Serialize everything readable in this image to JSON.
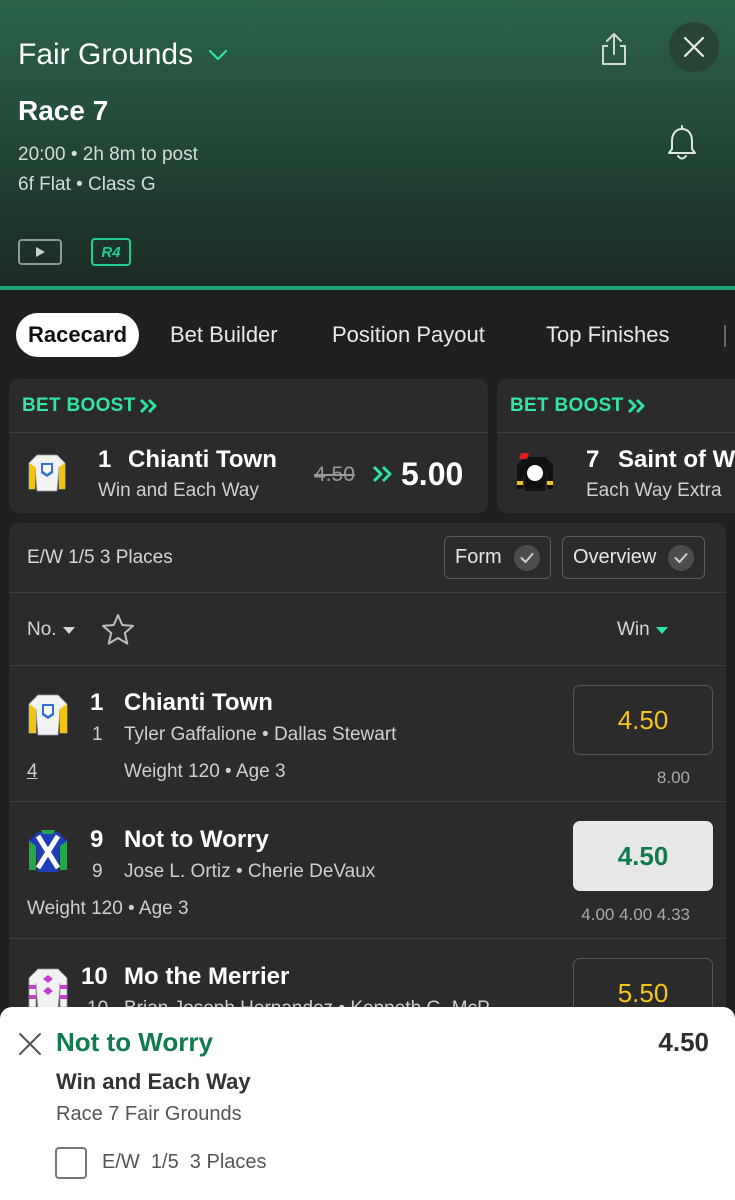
{
  "header": {
    "venue": "Fair Grounds",
    "race": "Race 7",
    "time": "20:00",
    "to_post": "2h 8m to post",
    "distance": "6f Flat",
    "race_class": "Class G",
    "badge": "R4",
    "icons": [
      "chevron-down-icon",
      "share-icon",
      "close-icon",
      "bell-icon",
      "play-icon"
    ]
  },
  "tabs": [
    "Racecard",
    "Bet Builder",
    "Position Payout",
    "Top Finishes"
  ],
  "boosts": [
    {
      "label": "BET BOOST",
      "number": "1",
      "name": "Chianti Town",
      "market": "Win and Each Way",
      "old_odds": "4.50",
      "new_odds": "5.00"
    },
    {
      "label": "BET BOOST",
      "number": "7",
      "name": "Saint of W",
      "market": "Each Way Extra"
    }
  ],
  "racecard": {
    "ew_terms": "E/W 1/5 3 Places",
    "form_label": "Form",
    "overview_label": "Overview",
    "col_no": "No.",
    "col_win": "Win"
  },
  "runners": [
    {
      "number": "1",
      "name": "Chianti Town",
      "draw": "1",
      "jockey": "Tyler Gaffalione",
      "trainer": "Dallas Stewart",
      "form": "4",
      "info": "Weight 120 • Age 3",
      "odds": "4.50",
      "history": "8.00",
      "selected": false
    },
    {
      "number": "9",
      "name": "Not to Worry",
      "draw": "9",
      "jockey": "Jose L. Ortiz",
      "trainer": "Cherie DeVaux",
      "info": "Weight 120 • Age 3",
      "odds": "4.50",
      "history": "4.00  4.00  4.33",
      "selected": true
    },
    {
      "number": "10",
      "name": "Mo the Merrier",
      "draw": "10",
      "jockey": "Brian Joseph Hernandez",
      "trainer": "Kenneth G. McP",
      "odds": "5.50",
      "selected": false
    }
  ],
  "betslip": {
    "selection": "Not to Worry",
    "odds": "4.50",
    "market": "Win and Each Way",
    "race": "Race 7 Fair Grounds",
    "ew_terms": "E/W  1/5  3 Places"
  },
  "colors": {
    "accent": "#2ee6a0",
    "header_green": "#2c6249",
    "odds_yellow": "#f5c518",
    "selected_green": "#127a4f"
  }
}
